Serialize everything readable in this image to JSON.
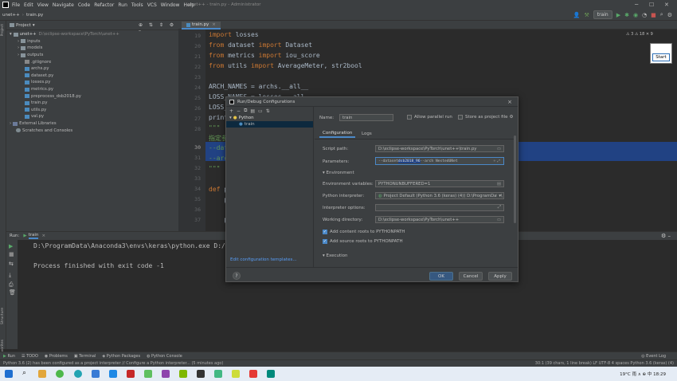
{
  "window": {
    "title": "unet++ - train.py - Administrator",
    "menu": [
      "File",
      "Edit",
      "View",
      "Navigate",
      "Code",
      "Refactor",
      "Run",
      "Tools",
      "VCS",
      "Window",
      "Help"
    ]
  },
  "navbar": {
    "project": "unet++",
    "file": "train.py"
  },
  "toolbar": {
    "run_config": "train",
    "warnings": "⚠ 3  ⚠ 18  ✕ 9"
  },
  "project_panel": {
    "header": "Project",
    "root_name": "unet++",
    "root_path": "D:\\eclipse-workspace\\PyTorch\\unet++",
    "items": [
      {
        "label": "inputs",
        "kind": "folder"
      },
      {
        "label": "models",
        "kind": "folder"
      },
      {
        "label": "outputs",
        "kind": "folder"
      },
      {
        "label": ".gitignore",
        "kind": "git"
      },
      {
        "label": "archs.py",
        "kind": "py"
      },
      {
        "label": "dataset.py",
        "kind": "py"
      },
      {
        "label": "losses.py",
        "kind": "py"
      },
      {
        "label": "metrics.py",
        "kind": "py"
      },
      {
        "label": "preprocess_dsb2018.py",
        "kind": "py"
      },
      {
        "label": "train.py",
        "kind": "py"
      },
      {
        "label": "utils.py",
        "kind": "py"
      },
      {
        "label": "val.py",
        "kind": "py"
      }
    ],
    "external": "External Libraries",
    "scratches": "Scratches and Consoles"
  },
  "editor": {
    "tab": "train.py",
    "line_numbers": [
      "19",
      "20",
      "21",
      "22",
      "23",
      "24",
      "25",
      "26",
      "27",
      "28",
      "29",
      "30",
      "31",
      "32",
      "33",
      "34",
      "35",
      "36",
      "37"
    ],
    "lines": {
      "l19_kw": "import",
      "l19_rest": " losses",
      "l20_kw1": "from",
      "l20_mid": " dataset ",
      "l20_kw2": "import",
      "l20_rest": " Dataset",
      "l21_kw1": "from",
      "l21_mid": " metrics ",
      "l21_kw2": "import",
      "l21_rest": " iou_score",
      "l22_kw1": "from",
      "l22_mid": " utils ",
      "l22_kw2": "import",
      "l22_rest": " AverageMeter, str2bool",
      "l24": "ARCH_NAMES = archs.__all__",
      "l25": "LOSS_NAMES = losses.__all__",
      "l26": "LOSS_",
      "l27": "print",
      "l28": "\"\"\"",
      "l29": "指定参",
      "l30": "--dat",
      "l31": "--arc",
      "l32": "\"\"\"",
      "l34_kw": "def",
      "l34_rest": " p",
      "l35": "    p",
      "l37": "    p"
    }
  },
  "preview": {
    "start_label": "Start"
  },
  "run_panel": {
    "label": "Run:",
    "tab": "train",
    "command": "D:\\ProgramData\\Anaconda3\\envs\\keras\\python.exe D:/ecli",
    "exit_message": "Process finished with exit code -1"
  },
  "bottom_tabs": [
    "Run",
    "TODO",
    "Problems",
    "Terminal",
    "Python Packages",
    "Python Console",
    "Event Log"
  ],
  "statusbar": {
    "left": "Python 3.6 (2) has been configured as a project interpreter // Configure a Python interpreter... (5 minutes ago)",
    "right": "30:1 (39 chars, 1 line break)  LF  UTF-8  4 spaces  Python 3.6 (keras) (4)"
  },
  "taskbar": {
    "tray": "19°C 雨  ∧  ⊕  中  18:29"
  },
  "dialog": {
    "title": "Run/Debug Configurations",
    "tree_group": "Python",
    "tree_item": "train",
    "edit_templates": "Edit configuration templates...",
    "name_label": "Name:",
    "name_value": "train",
    "allow_parallel": "Allow parallel run",
    "store_as_project": "Store as project file",
    "tab_configuration": "Configuration",
    "tab_logs": "Logs",
    "script_path_label": "Script path:",
    "script_path_value": "D:\\eclipse-workspace\\PyTorch\\unet++\\train.py",
    "parameters_label": "Parameters:",
    "parameters_value_pre": "--dataset ",
    "parameters_value_sel": "dsb2018_96",
    "parameters_value_post": " --arch NestedUNet",
    "environment_section": "Environment",
    "env_vars_label": "Environment variables:",
    "env_vars_value": "PYTHONUNBUFFERED=1",
    "interpreter_label": "Python interpreter:",
    "interpreter_value": "Project Default (Python 3.6 (keras) (4)) D:\\ProgramData\\",
    "interp_options_label": "Interpreter options:",
    "working_dir_label": "Working directory:",
    "working_dir_value": "D:\\eclipse-workspace\\PyTorch\\unet++",
    "add_content_roots": "Add content roots to PYTHONPATH",
    "add_source_roots": "Add source roots to PYTHONPATH",
    "execution_section": "Execution",
    "ok": "OK",
    "cancel": "Cancel",
    "apply": "Apply",
    "help": "?"
  },
  "colors": {
    "accent": "#4a88c7",
    "selection": "#214283",
    "keyword": "#cc7832",
    "string": "#6a8759"
  }
}
